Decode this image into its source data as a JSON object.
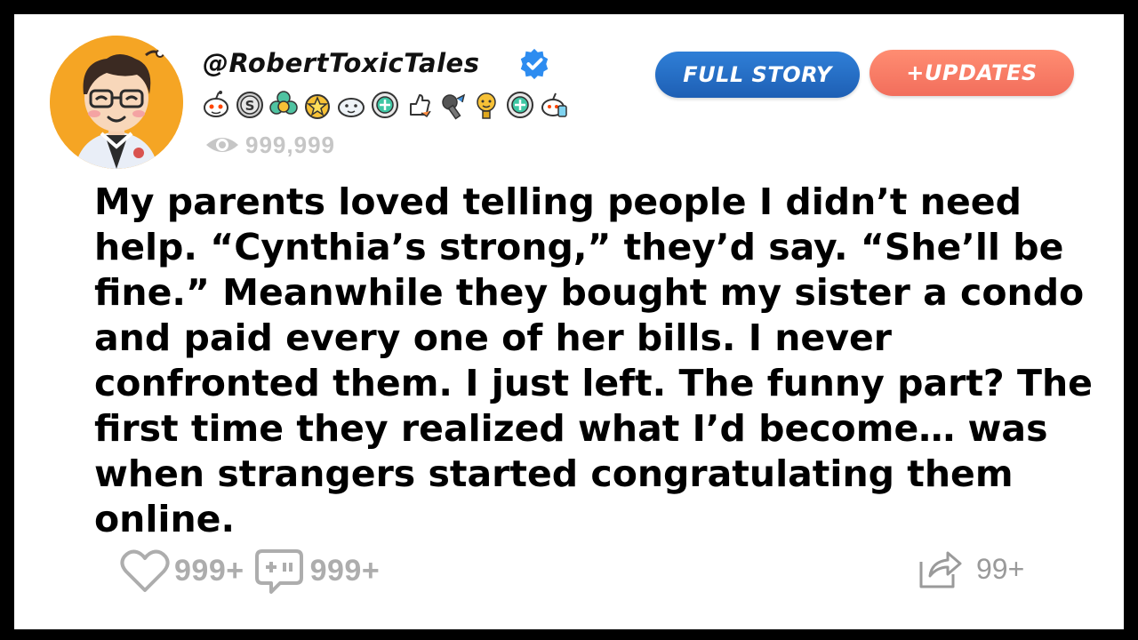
{
  "post": {
    "username": "@RobertToxicTales",
    "views": "999,999",
    "story": "My parents loved telling people I didn’t need help. “Cynthia’s strong,” they’d say. “She’ll be fine.” Meanwhile they bought my sister a condo and paid every one of her bills. I never confronted them. I just left. The funny part? The first time they realized what I’d become… was when strangers started congratulating them online."
  },
  "buttons": {
    "full_story": "FULL STORY",
    "updates": "+UPDATES"
  },
  "stats": {
    "likes": "999+",
    "comments": "999+",
    "shares": "99+"
  },
  "colors": {
    "frame": "#000000",
    "avatar_bg": "#f5a524",
    "verified": "#2d8cf0",
    "full_story_btn": "#1e5fb4",
    "updates_btn": "#f26e5c",
    "stat_gray": "#adadad"
  },
  "badges": [
    "reddit-alien-icon",
    "silver-coin-icon",
    "gold-flower-icon",
    "star-medal-icon",
    "seal-icon",
    "helpful-badge-icon",
    "thumbs-up-icon",
    "wrench-icon",
    "sun-trophy-icon",
    "helpful-badge-icon",
    "reddit-gold-icon"
  ]
}
